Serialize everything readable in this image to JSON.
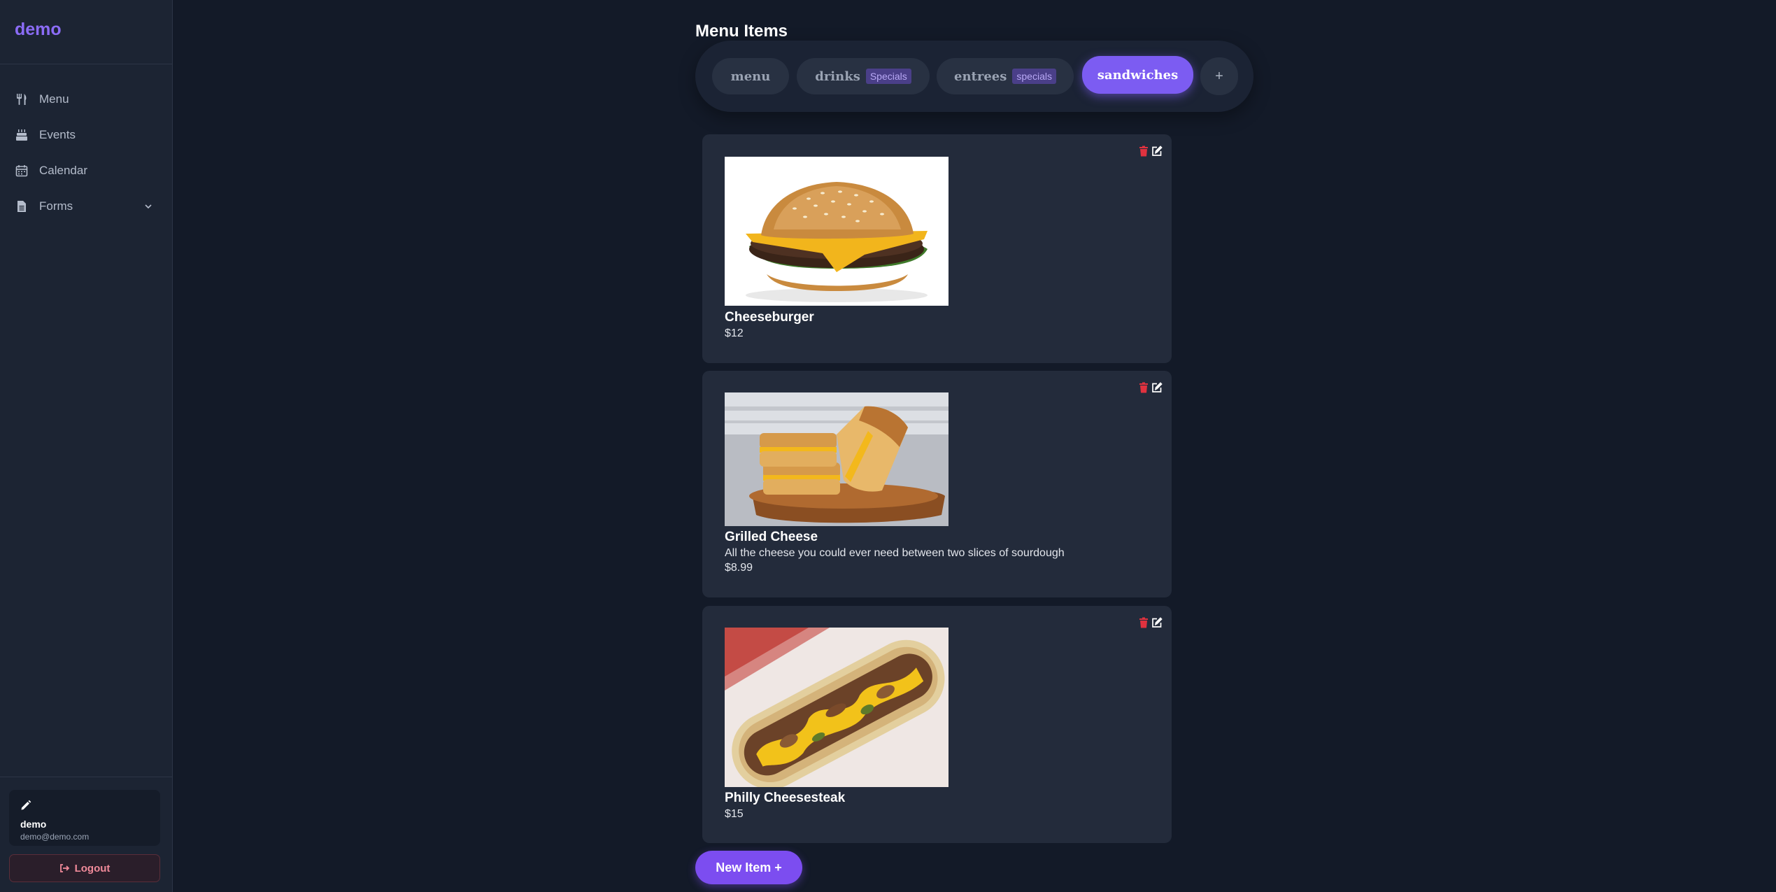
{
  "app": {
    "brand": "demo"
  },
  "sidebar": {
    "items": [
      {
        "label": "Menu",
        "icon": "utensils-icon"
      },
      {
        "label": "Events",
        "icon": "cake-icon"
      },
      {
        "label": "Calendar",
        "icon": "calendar-icon"
      },
      {
        "label": "Forms",
        "icon": "document-icon",
        "has_submenu": true
      }
    ],
    "user": {
      "name": "demo",
      "email": "demo@demo.com"
    },
    "logout_label": "Logout"
  },
  "main": {
    "title": "Menu Items",
    "tabs": [
      {
        "label": "menu",
        "badge": ""
      },
      {
        "label": "drinks",
        "badge": "Specials"
      },
      {
        "label": "entrees",
        "badge": "specials"
      },
      {
        "label": "sandwiches",
        "badge": "",
        "active": true
      }
    ],
    "add_tab_label": "+",
    "items": [
      {
        "name": "Cheeseburger",
        "description": "",
        "price": "$12"
      },
      {
        "name": "Grilled Cheese",
        "description": "All the cheese you could ever need between two slices of sourdough",
        "price": "$8.99"
      },
      {
        "name": "Philly Cheesesteak",
        "description": "",
        "price": "$15"
      }
    ],
    "new_item_label": "New Item +"
  },
  "colors": {
    "accent": "#7c5cf2",
    "background": "#131a28",
    "sidebar": "#1c2433",
    "card": "#232b3b",
    "danger": "#e0323f"
  }
}
